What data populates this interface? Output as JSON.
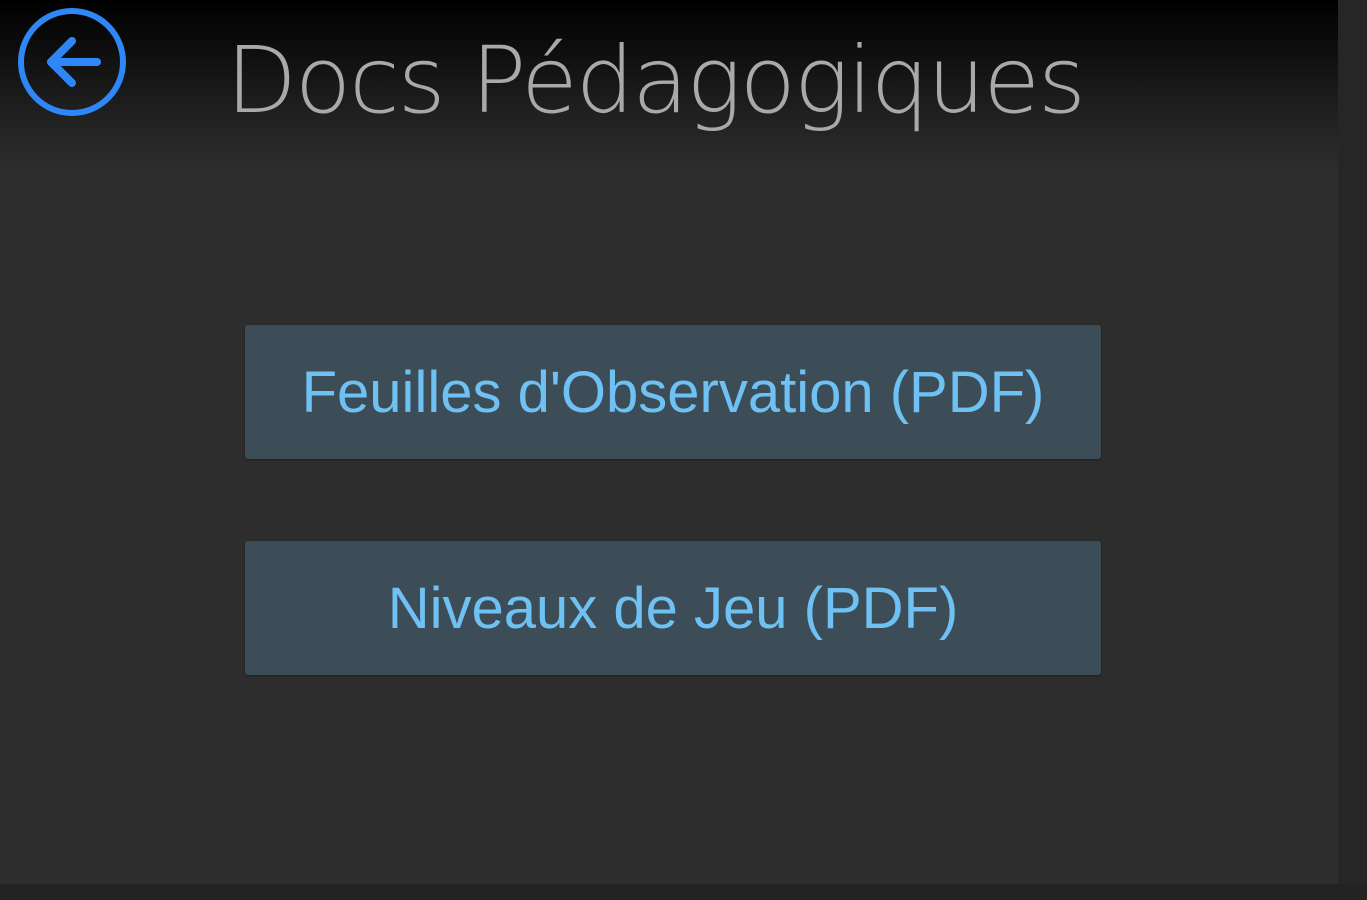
{
  "header": {
    "title": "Docs Pédagogiques",
    "back_icon": "arrow-left-circle-icon",
    "accent_color": "#2f86f6"
  },
  "documents": [
    {
      "label": "Feuilles d'Observation (PDF)"
    },
    {
      "label": "Niveaux de Jeu (PDF)"
    }
  ],
  "colors": {
    "background": "#2d2d2d",
    "button_background": "#3d4d58",
    "button_text": "#6ec1f2",
    "title_text": "#a9a9a9"
  }
}
